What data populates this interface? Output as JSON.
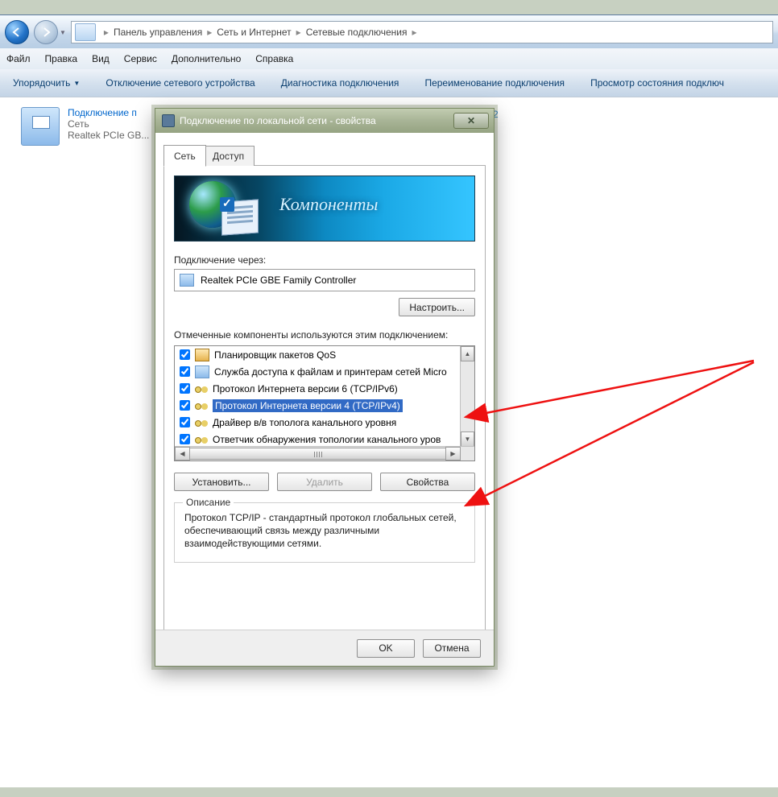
{
  "breadcrumb": {
    "a": "Панель управления",
    "b": "Сеть и Интернет",
    "c": "Сетевые подключения"
  },
  "menubar": {
    "file": "Файл",
    "edit": "Правка",
    "view": "Вид",
    "service": "Сервис",
    "extra": "Дополнительно",
    "help": "Справка"
  },
  "toolbar": {
    "organize": "Упорядочить",
    "disable": "Отключение сетевого устройства",
    "diag": "Диагностика подключения",
    "rename": "Переименование подключения",
    "status": "Просмотр состояния подключ"
  },
  "conn": {
    "title": "Подключение п",
    "l2": "Сеть",
    "l3": "Realtek PCIe GB...",
    "second": " 2"
  },
  "dialog": {
    "title": "Подключение по локальной сети - свойства",
    "tabs": {
      "net": "Сеть",
      "access": "Доступ"
    },
    "banner": "Компоненты",
    "connect_via": "Подключение через:",
    "adapter": "Realtek PCIe GBE Family Controller",
    "configure": "Настроить...",
    "list_lbl": "Отмеченные компоненты используются этим подключением:",
    "items": [
      {
        "label": "Планировщик пакетов QoS",
        "icon": "sched"
      },
      {
        "label": "Служба доступа к файлам и принтерам сетей Micro",
        "icon": "net"
      },
      {
        "label": "Протокол Интернета версии 6 (TCP/IPv6)",
        "icon": "prot"
      },
      {
        "label": "Протокол Интернета версии 4 (TCP/IPv4)",
        "icon": "prot",
        "selected": true
      },
      {
        "label": "Драйвер в/в тополога канального уровня",
        "icon": "prot"
      },
      {
        "label": "Ответчик обнаружения топологии канального уров",
        "icon": "prot"
      }
    ],
    "install": "Установить...",
    "remove": "Удалить",
    "props": "Свойства",
    "desc_lbl": "Описание",
    "desc": "Протокол TCP/IP - стандартный протокол глобальных сетей, обеспечивающий связь между различными взаимодействующими сетями.",
    "ok": "OK",
    "cancel": "Отмена"
  }
}
